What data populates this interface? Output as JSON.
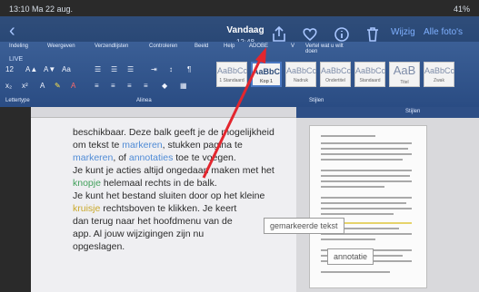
{
  "status_bar": {
    "time_date": "13:10  Ma 22 aug.",
    "battery": "41%"
  },
  "nav": {
    "title": "Vandaag",
    "subtitle": "12:48",
    "edit_label": "Wijzig",
    "all_photos_label": "Alle foto's",
    "icons": [
      "back-chevron-icon",
      "share-icon",
      "heart-icon",
      "info-icon",
      "trash-icon"
    ]
  },
  "ribbon": {
    "tabs": [
      "Indeling",
      "Weergeven",
      "Verzendlijsten",
      "Controleren",
      "Beeld",
      "Help",
      "ADOBE",
      "V",
      "Vertel wat u wilt doen"
    ],
    "left_label": "LIVE",
    "font_size": "12",
    "styles": [
      {
        "preview": "AaBbCc",
        "name": "1 Standaard"
      },
      {
        "preview": "AaBbC",
        "name": "Kop 1"
      },
      {
        "preview": "AaBbCc",
        "name": "Nadruk"
      },
      {
        "preview": "AaBbCc",
        "name": "Ondertitel"
      },
      {
        "preview": "AaBbCc",
        "name": "Standaard"
      },
      {
        "preview": "AaB",
        "name": "Titel"
      },
      {
        "preview": "AaBbCc",
        "name": "Zwak"
      }
    ],
    "group_labels": [
      "Lettertype",
      "Alinea",
      "Stijlen"
    ]
  },
  "document": {
    "lines": [
      {
        "parts": [
          {
            "t": "beschikbaar. Deze balk geeft je de mogelijkheid",
            "c": ""
          }
        ]
      },
      {
        "parts": [
          {
            "t": "om tekst te ",
            "c": ""
          },
          {
            "t": "markeren",
            "c": "hl-blue"
          },
          {
            "t": ", stukken pagina te",
            "c": ""
          }
        ]
      },
      {
        "parts": [
          {
            "t": "markeren",
            "c": "hl-blue"
          },
          {
            "t": ", of ",
            "c": ""
          },
          {
            "t": "annotaties",
            "c": "hl-blue"
          },
          {
            "t": " toe te voegen.",
            "c": ""
          }
        ]
      },
      {
        "parts": [
          {
            "t": "Je kunt je acties altijd ongedaan maken met het",
            "c": ""
          }
        ]
      },
      {
        "parts": [
          {
            "t": "knopje",
            "c": "hl-green"
          },
          {
            "t": " helemaal rechts in de balk.",
            "c": ""
          }
        ]
      },
      {
        "parts": [
          {
            "t": "Je kunt het bestand sluiten door op het kleine",
            "c": ""
          }
        ]
      },
      {
        "parts": [
          {
            "t": "kruisje",
            "c": "hl-yellow"
          },
          {
            "t": " rechtsboven te klikken. Je keert",
            "c": ""
          }
        ]
      },
      {
        "parts": [
          {
            "t": "dan terug naar het hoofdmenu van de",
            "c": ""
          }
        ]
      },
      {
        "parts": [
          {
            "t": "app. Al jouw wijzigingen zijn nu",
            "c": ""
          }
        ]
      },
      {
        "parts": [
          {
            "t": "opgeslagen.",
            "c": ""
          }
        ]
      }
    ]
  },
  "sidebar": {
    "header": "Stijlen",
    "callouts": [
      "gemarkeerde tekst",
      "annotatie"
    ]
  },
  "colors": {
    "nav_bg": "#2f4d7a",
    "link": "#7fb0ff",
    "arrow": "#e3262e",
    "highlight_blue": "#4f8bd6"
  }
}
